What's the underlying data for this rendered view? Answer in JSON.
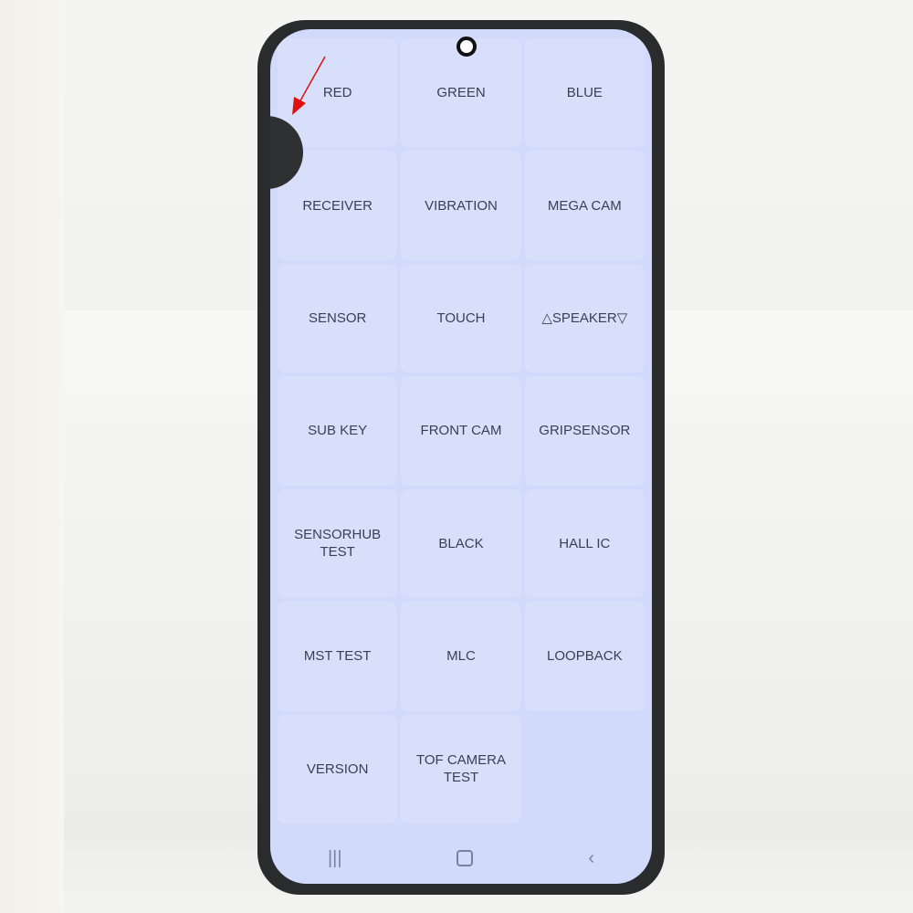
{
  "tiles": [
    {
      "label": "RED"
    },
    {
      "label": "GREEN"
    },
    {
      "label": "BLUE"
    },
    {
      "label": "RECEIVER"
    },
    {
      "label": "VIBRATION"
    },
    {
      "label": "MEGA CAM"
    },
    {
      "label": "SENSOR"
    },
    {
      "label": "TOUCH"
    },
    {
      "label": "△SPEAKER▽"
    },
    {
      "label": "SUB KEY"
    },
    {
      "label": "FRONT CAM"
    },
    {
      "label": "GRIPSENSOR"
    },
    {
      "label": "SENSORHUB TEST"
    },
    {
      "label": "BLACK"
    },
    {
      "label": "HALL IC"
    },
    {
      "label": "MST TEST"
    },
    {
      "label": "MLC"
    },
    {
      "label": "LOOPBACK"
    },
    {
      "label": "VERSION"
    },
    {
      "label": "TOF CAMERA TEST"
    }
  ],
  "nav": {
    "recents": "|||",
    "back": "‹"
  },
  "colors": {
    "screen": "#d2dafc",
    "text": "#3a3f52",
    "arrow": "#e01010"
  },
  "icons": {
    "recents": "recents-icon",
    "home": "home-icon",
    "back": "back-icon",
    "annotation": "red-arrow-icon"
  }
}
